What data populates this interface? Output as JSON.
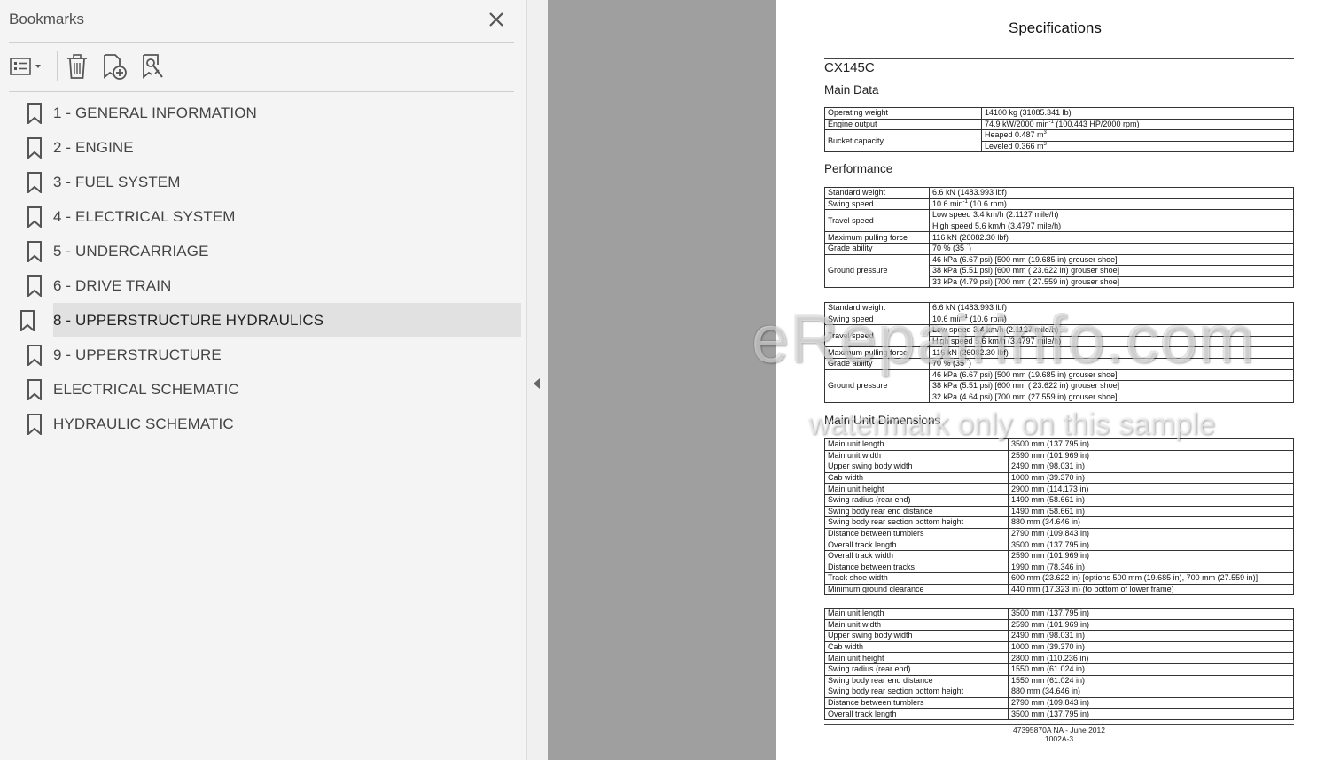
{
  "bookmarks_panel": {
    "title": "Bookmarks",
    "items": [
      {
        "label": "1 - GENERAL INFORMATION"
      },
      {
        "label": "2 - ENGINE"
      },
      {
        "label": "3 - FUEL SYSTEM"
      },
      {
        "label": "4 - ELECTRICAL SYSTEM"
      },
      {
        "label": "5 - UNDERCARRIAGE"
      },
      {
        "label": "6 - DRIVE TRAIN"
      },
      {
        "label": "8 - UPPERSTRUCTURE HYDRAULICS"
      },
      {
        "label": "9 - UPPERSTRUCTURE"
      },
      {
        "label": "ELECTRICAL SCHEMATIC"
      },
      {
        "label": "HYDRAULIC SCHEMATIC"
      }
    ],
    "selected_index": 6,
    "icons": [
      "options-icon",
      "delete-icon",
      "add-bookmark-icon",
      "find-bookmark-icon",
      "close-icon",
      "bookmark-icon"
    ]
  },
  "document": {
    "title": "Specifications",
    "model": "CX145C",
    "sections": {
      "main_data": "Main Data",
      "performance": "Performance",
      "dimensions": "Main Unit Dimensions"
    },
    "main_data_rows": {
      "operating_weight": {
        "label": "Operating weight",
        "value": "14100 kg (31085.341 lb)"
      },
      "engine_output": {
        "label": "Engine output",
        "value_a": "74.9 kW/2000 min",
        "sup": "-1",
        "value_b": " (100.443 HP/2000 rpm)"
      },
      "bucket_capacity": {
        "label": "Bucket capacity",
        "heaped": "Heaped 0.487 m",
        "leveled": "Leveled 0.366 m",
        "cube": "3"
      }
    },
    "performance_1": {
      "standard_weight": {
        "label": "Standard weight",
        "value": "6.6 kN (1483.993 lbf)"
      },
      "swing_speed": {
        "label": "Swing speed",
        "value_a": "10.6 min",
        "sup": "-1",
        "value_b": " (10.6 rpm)"
      },
      "travel_speed": {
        "label": "Travel speed",
        "low": "Low speed 3.4 km/h (2.1127 mile/h)",
        "high": "High speed 5.6 km/h (3.4797 mile/h)"
      },
      "max_pulling": {
        "label": "Maximum pulling force",
        "value": "116 kN (26082.30 lbf)"
      },
      "grade_ability": {
        "label": "Grade ability",
        "value_a": "70 % (35 ",
        "deg": "°",
        "value_b": ")"
      },
      "ground_pressure": {
        "label": "Ground pressure",
        "v1": "46 kPa (6.67 psi) [500 mm (19.685 in) grouser shoe]",
        "v2": "38 kPa (5.51 psi) [600 mm ( 23.622 in) grouser shoe]",
        "v3": "33 kPa (4.79 psi) [700 mm ( 27.559 in) grouser shoe]"
      }
    },
    "performance_2": {
      "standard_weight": {
        "label": "Standard weight",
        "value": "6.6 kN (1483.993 lbf)"
      },
      "swing_speed": {
        "label": "Swing speed",
        "value_a": "10.6 min",
        "sup": "-1",
        "value_b": " (10.6 rpm)"
      },
      "travel_speed": {
        "label": "Travel speed",
        "low": "Low speed 3.4 km/h (2.1127 mile/h)",
        "high": "High speed 5.6 km/h (3.4797 mile/h)"
      },
      "max_pulling": {
        "label": "Maximum pulling force",
        "value": "116 kN (26082.30 lbf)"
      },
      "grade_ability": {
        "label": "Grade ability",
        "value_a": "70 % (35 ",
        "deg": "°",
        "value_b": ")"
      },
      "ground_pressure": {
        "label": "Ground pressure",
        "v1": "46 kPa (6.67 psi) [500 mm (19.685 in) grouser shoe]",
        "v2": "38 kPa (5.51 psi) [600 mm ( 23.622 in) grouser shoe]",
        "v3": "32 kPa (4.64 psi) [700 mm (27.559 in) grouser shoe]"
      }
    },
    "dimensions_1": [
      [
        "Main unit length",
        "3500 mm (137.795 in)"
      ],
      [
        "Main unit width",
        "2590 mm (101.969 in)"
      ],
      [
        "Upper swing body width",
        "2490 mm (98.031 in)"
      ],
      [
        "Cab width",
        "1000 mm (39.370 in)"
      ],
      [
        "Main unit height",
        "2900 mm (114.173 in)"
      ],
      [
        "Swing radius (rear end)",
        "1490 mm (58.661 in)"
      ],
      [
        "Swing body rear end distance",
        "1490 mm (58.661 in)"
      ],
      [
        "Swing body rear section bottom height",
        "880 mm (34.646 in)"
      ],
      [
        "Distance between tumblers",
        "2790 mm (109.843 in)"
      ],
      [
        "Overall track length",
        "3500 mm (137.795 in)"
      ],
      [
        "Overall track width",
        "2590 mm (101.969 in)"
      ],
      [
        "Distance between tracks",
        "1990 mm (78.346 in)"
      ],
      [
        "Track shoe width",
        "600 mm (23.622 in) [options 500 mm (19.685 in), 700 mm (27.559 in)]"
      ],
      [
        "Minimum ground clearance",
        "440 mm (17.323 in) (to bottom of lower frame)"
      ]
    ],
    "dimensions_2": [
      [
        "Main unit length",
        "3500 mm (137.795 in)"
      ],
      [
        "Main unit width",
        "2590 mm (101.969 in)"
      ],
      [
        "Upper swing body width",
        "2490 mm (98.031 in)"
      ],
      [
        "Cab width",
        "1000 mm (39.370 in)"
      ],
      [
        "Main unit height",
        "2800 mm (110.236 in)"
      ],
      [
        "Swing radius (rear end)",
        "1550 mm (61.024 in)"
      ],
      [
        "Swing body rear end distance",
        "1550 mm (61.024 in)"
      ],
      [
        "Swing body rear section bottom height",
        "880 mm (34.646 in)"
      ],
      [
        "Distance between tumblers",
        "2790 mm (109.843 in)"
      ],
      [
        "Overall track length",
        "3500 mm (137.795 in)"
      ]
    ],
    "footer": {
      "line1": "47395870A NA - June 2012",
      "line2": "1002A-3"
    }
  },
  "watermark": {
    "main": "eRepairinfo.com",
    "sub": "watermark only on this sample"
  }
}
